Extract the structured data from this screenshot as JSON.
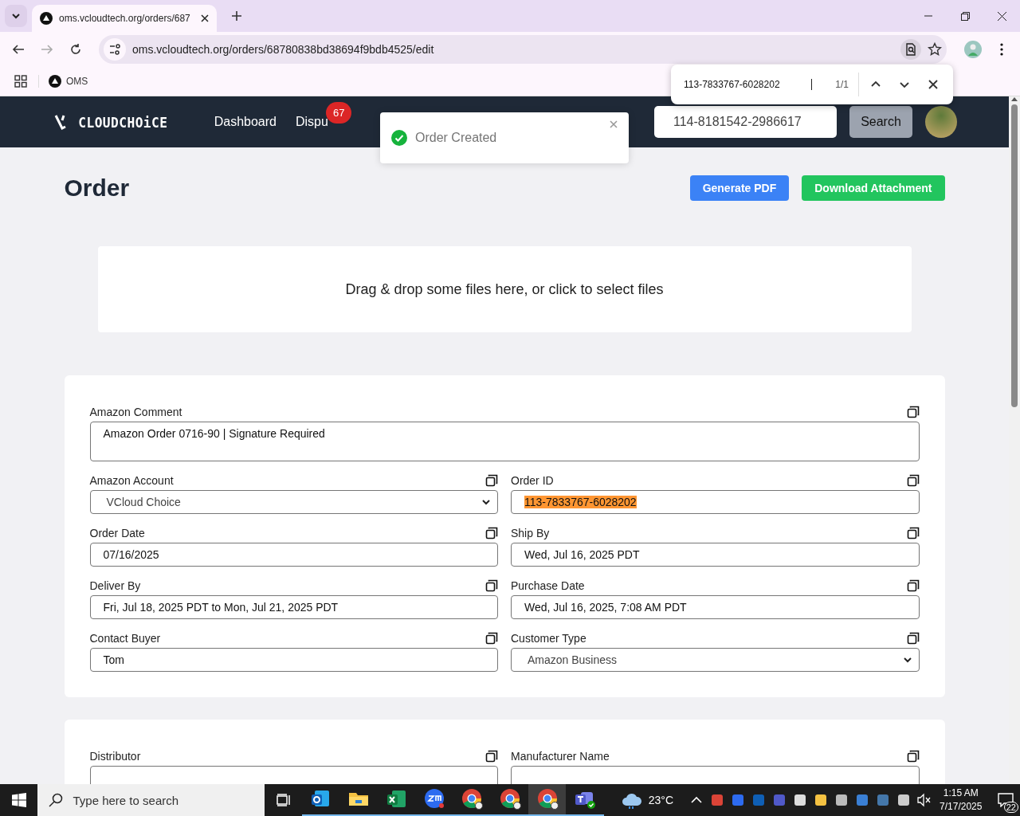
{
  "browser": {
    "tabs": [
      {
        "title": "oms.vcloudtech.org/orders/687",
        "selected": true
      }
    ],
    "url": "oms.vcloudtech.org/orders/68780838bd38694f9bdb4525/edit",
    "bookmarks": [
      {
        "label": "OMS"
      }
    ]
  },
  "find_bar": {
    "query": "113-7833767-6028202",
    "count": "1/1"
  },
  "navbar": {
    "logo": "CLOUDCHOiCE",
    "links": [
      {
        "label": "Dashboard"
      },
      {
        "label": "Dispu",
        "badge": "67"
      }
    ],
    "search": {
      "value": "114-8181542-2986617"
    },
    "search_button": "Search"
  },
  "toast": {
    "message": "Order Created"
  },
  "page": {
    "title": "Order",
    "buttons": [
      {
        "label": "Generate PDF",
        "kind": "primary"
      },
      {
        "label": "Download Attachment",
        "kind": "success"
      }
    ],
    "dropzone": "Drag & drop some files here, or click to select files"
  },
  "cards": [
    {
      "fields": [
        {
          "label": "Amazon Comment",
          "kind": "textarea",
          "value": "Amazon Order 0716-90 | Signature Required"
        },
        {
          "label": "Amazon Account",
          "kind": "select",
          "value": "VCloud Choice"
        },
        {
          "label": "Order ID",
          "kind": "text",
          "value": "113-7833767-6028202",
          "highlighted": true
        },
        {
          "label": "Order Date",
          "kind": "text",
          "value": "07/16/2025"
        },
        {
          "label": "Ship By",
          "kind": "text",
          "value": "Wed, Jul 16, 2025 PDT"
        },
        {
          "label": "Deliver By",
          "kind": "text",
          "value": "Fri, Jul 18, 2025 PDT to Mon, Jul 21, 2025 PDT"
        },
        {
          "label": "Purchase Date",
          "kind": "text",
          "value": "Wed, Jul 16, 2025, 7:08 AM PDT"
        },
        {
          "label": "Contact Buyer",
          "kind": "text",
          "value": "Tom"
        },
        {
          "label": "Customer Type",
          "kind": "select",
          "value": "Amazon Business"
        }
      ]
    },
    {
      "fields": [
        {
          "label": "Distributor",
          "kind": "text"
        },
        {
          "label": "Manufacturer Name",
          "kind": "text"
        }
      ]
    }
  ],
  "taskbar": {
    "search_placeholder": "Type here to search",
    "apps": [
      {
        "kind": "outlook",
        "selected": false
      },
      {
        "kind": "explorer",
        "selected": false
      },
      {
        "kind": "excel",
        "selected": false
      },
      {
        "kind": "zoom",
        "selected": false
      },
      {
        "kind": "chrome",
        "selected": false
      },
      {
        "kind": "chrome",
        "selected": false
      },
      {
        "kind": "chrome",
        "selected": true
      },
      {
        "kind": "teams",
        "selected": false
      }
    ],
    "weather": "23°C",
    "time": "1:15 AM",
    "date": "7/17/2025",
    "notifications": "22"
  }
}
